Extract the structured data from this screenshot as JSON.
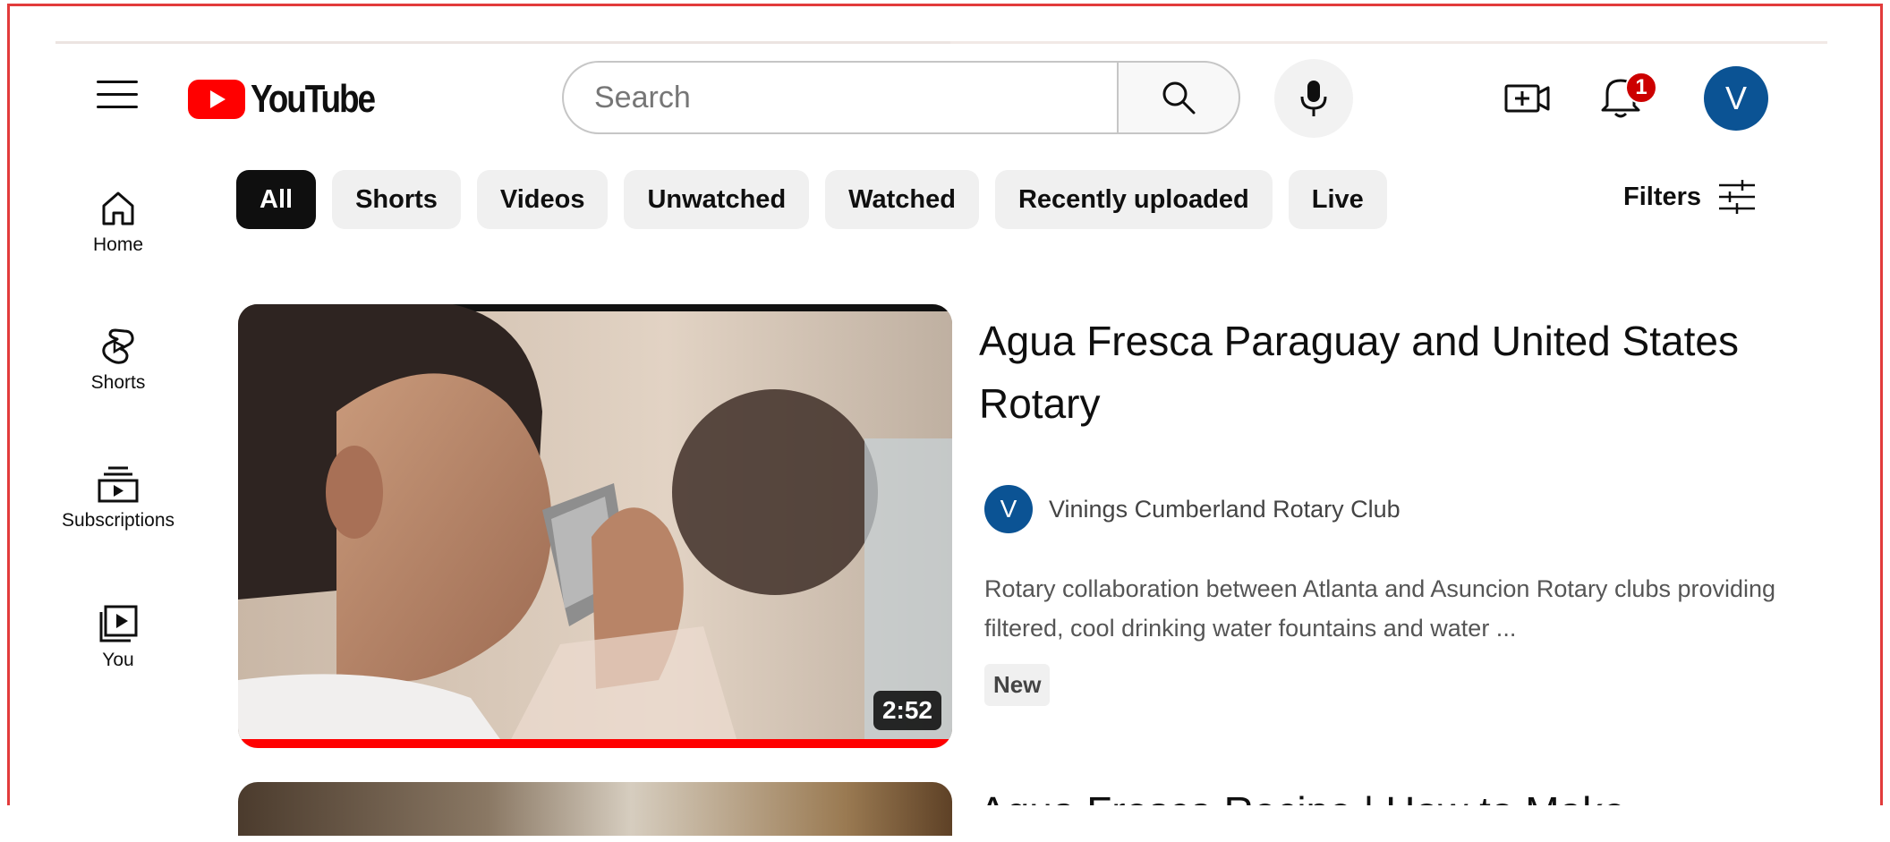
{
  "header": {
    "logo_text": "YouTube",
    "search_placeholder": "Search",
    "notification_count": "1",
    "avatar_letter": "V"
  },
  "sidebar": {
    "items": [
      {
        "label": "Home",
        "icon": "home-icon"
      },
      {
        "label": "Shorts",
        "icon": "shorts-icon"
      },
      {
        "label": "Subscriptions",
        "icon": "subscriptions-icon"
      },
      {
        "label": "You",
        "icon": "you-icon"
      }
    ]
  },
  "chips": [
    {
      "label": "All",
      "active": true
    },
    {
      "label": "Shorts"
    },
    {
      "label": "Videos"
    },
    {
      "label": "Unwatched"
    },
    {
      "label": "Watched"
    },
    {
      "label": "Recently uploaded"
    },
    {
      "label": "Live"
    }
  ],
  "filters_label": "Filters",
  "videos": [
    {
      "title": "Agua Fresca Paraguay and United States Rotary",
      "channel": "Vinings Cumberland Rotary Club",
      "channel_avatar_letter": "V",
      "description": "Rotary collaboration between Atlanta and Asuncion Rotary clubs providing filtered, cool drinking water fountains and water ...",
      "badge": "New",
      "duration": "2:52",
      "watched_fraction": 1.0
    },
    {
      "title": "Agua Fresca Recipe | How to Make"
    }
  ],
  "colors": {
    "brand_red": "#ff0000",
    "avatar_blue": "#0b5394",
    "notification_red": "#cc0000",
    "chip_bg": "#f0f0f0",
    "chip_active_bg": "#0f0f0f"
  }
}
